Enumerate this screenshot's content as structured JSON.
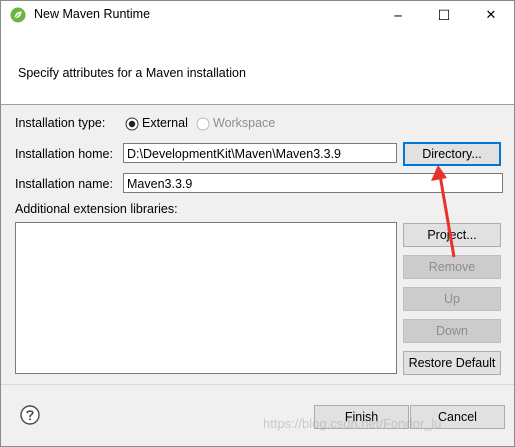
{
  "window": {
    "title": "New Maven Runtime",
    "controls": {
      "minimize": "─",
      "maximize": "☐",
      "close": "✕"
    }
  },
  "header": {
    "message": "Specify attributes for a Maven installation"
  },
  "form": {
    "installation_type_label": "Installation type:",
    "type_options": [
      {
        "label": "External",
        "selected": true,
        "enabled": true
      },
      {
        "label": "Workspace",
        "selected": false,
        "enabled": false
      }
    ],
    "installation_home_label": "Installation home:",
    "installation_home_value": "D:\\DevelopmentKit\\Maven\\Maven3.3.9",
    "directory_button": "Directory...",
    "installation_name_label": "Installation name:",
    "installation_name_value": "Maven3.3.9",
    "extension_libraries_label": "Additional extension libraries:"
  },
  "side_buttons": {
    "project": "Project...",
    "remove": "Remove",
    "up": "Up",
    "down": "Down",
    "restore_default": "Restore Default"
  },
  "footer": {
    "finish": "Finish",
    "cancel": "Cancel"
  },
  "watermark": "https://blog.csdn.net/Fondor_lu",
  "colors": {
    "accent": "#0078d7",
    "arrow": "#e8312a",
    "spring_green": "#6db33f"
  },
  "icons": {
    "app": "spring-leaf-icon",
    "help": "help-question-icon"
  }
}
